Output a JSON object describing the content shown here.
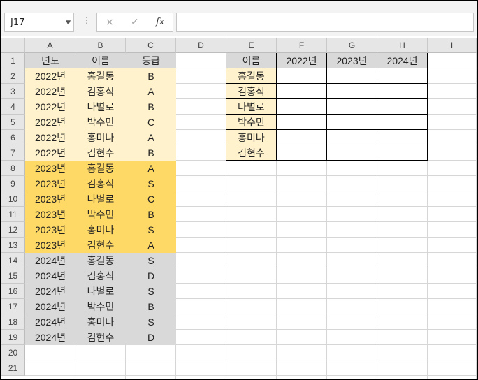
{
  "name_box": "J17",
  "formula_bar": {
    "cancel_icon": "×",
    "enter_icon": "✓",
    "fx_label": "fx",
    "formula": ""
  },
  "columns": [
    "A",
    "B",
    "C",
    "D",
    "E",
    "F",
    "G",
    "H",
    "I"
  ],
  "rows": [
    "1",
    "2",
    "3",
    "4",
    "5",
    "6",
    "7",
    "8",
    "9",
    "10",
    "11",
    "12",
    "13",
    "14",
    "15",
    "16",
    "17",
    "18",
    "19",
    "20",
    "21"
  ],
  "table1": {
    "headers": [
      "년도",
      "이름",
      "등급"
    ],
    "records": [
      [
        "2022년",
        "홍길동",
        "B"
      ],
      [
        "2022년",
        "김홍식",
        "A"
      ],
      [
        "2022년",
        "나별로",
        "B"
      ],
      [
        "2022년",
        "박수민",
        "C"
      ],
      [
        "2022년",
        "홍미나",
        "A"
      ],
      [
        "2022년",
        "김현수",
        "B"
      ],
      [
        "2023년",
        "홍길동",
        "A"
      ],
      [
        "2023년",
        "김홍식",
        "S"
      ],
      [
        "2023년",
        "나별로",
        "C"
      ],
      [
        "2023년",
        "박수민",
        "B"
      ],
      [
        "2023년",
        "홍미나",
        "S"
      ],
      [
        "2023년",
        "김현수",
        "A"
      ],
      [
        "2024년",
        "홍길동",
        "S"
      ],
      [
        "2024년",
        "김홍식",
        "D"
      ],
      [
        "2024년",
        "나별로",
        "S"
      ],
      [
        "2024년",
        "박수민",
        "B"
      ],
      [
        "2024년",
        "홍미나",
        "S"
      ],
      [
        "2024년",
        "김현수",
        "D"
      ]
    ]
  },
  "table2": {
    "headers": [
      "이름",
      "2022년",
      "2023년",
      "2024년"
    ],
    "names": [
      "홍길동",
      "김홍식",
      "나별로",
      "박수민",
      "홍미나",
      "김현수"
    ]
  },
  "colors": {
    "y2022": "#fff2cc",
    "y2023": "#ffd966",
    "y2024": "#d9d9d9",
    "header": "#d9d9d9"
  }
}
